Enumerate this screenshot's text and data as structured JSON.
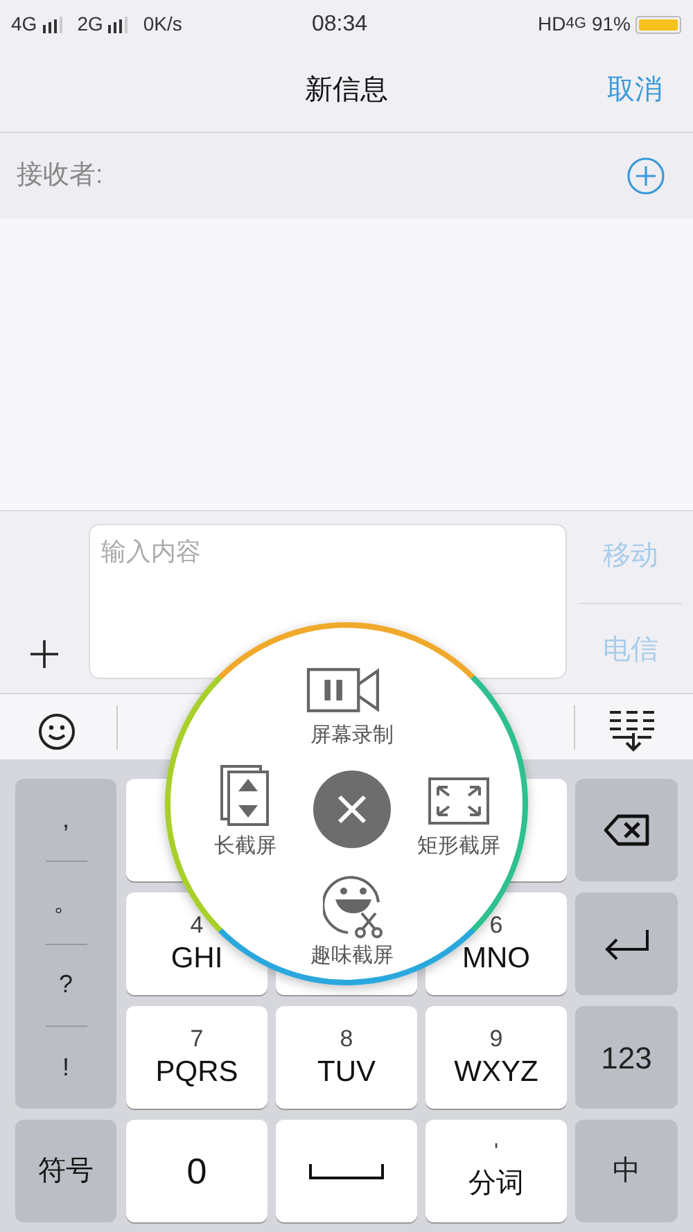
{
  "status_bar": {
    "network_1": "4G",
    "network_2": "2G",
    "speed": "0K/s",
    "time": "08:34",
    "hd": "HD",
    "network_3": "4G",
    "battery": "91%"
  },
  "nav_bar": {
    "title": "新信息",
    "cancel": "取消"
  },
  "recipient": {
    "label": "接收者:"
  },
  "composer": {
    "placeholder": "输入内容",
    "send_options": [
      "移动",
      "电信"
    ]
  },
  "keyboard": {
    "symbols": [
      ",",
      "。",
      "?",
      "!"
    ],
    "keys": [
      {
        "kind": "blank"
      },
      {
        "kind": "blank"
      },
      {
        "kind": "blank"
      },
      {
        "kind": "letters",
        "digit": "4",
        "letters": "GHI"
      },
      {
        "kind": "blank"
      },
      {
        "kind": "letters",
        "digit": "6",
        "letters": "MNO"
      },
      {
        "kind": "letters",
        "digit": "7",
        "letters": "PQRS"
      },
      {
        "kind": "letters",
        "digit": "8",
        "letters": "TUV"
      },
      {
        "kind": "letters",
        "digit": "9",
        "letters": "WXYZ"
      },
      {
        "kind": "digit",
        "label": "0"
      },
      {
        "kind": "space"
      },
      {
        "kind": "word",
        "hint": "'",
        "label": "分词"
      }
    ],
    "symbol_key": "符号",
    "number_key": "123",
    "language_key": "中"
  },
  "screenshot_menu": {
    "items": [
      {
        "kind": "record",
        "label": "屏幕录制"
      },
      {
        "kind": "long",
        "label": "长截屏"
      },
      {
        "kind": "rect",
        "label": "矩形截屏"
      },
      {
        "kind": "fun",
        "label": "趣味截屏"
      }
    ]
  }
}
